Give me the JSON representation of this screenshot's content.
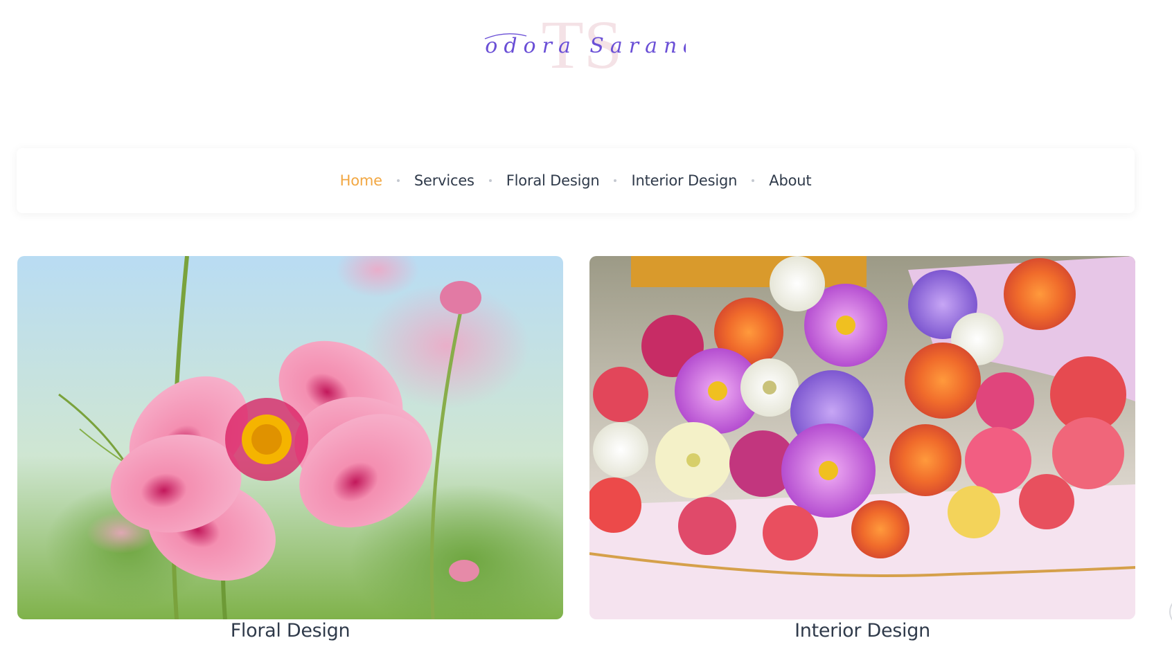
{
  "logo": {
    "monogram": "TS",
    "signature": "Teodora Sarandi",
    "colors": {
      "signature": "#6a4fd6",
      "monogram": "#f3dde2"
    }
  },
  "nav": {
    "items": [
      {
        "label": "Home",
        "active": true
      },
      {
        "label": "Services",
        "active": false
      },
      {
        "label": "Floral Design",
        "active": false
      },
      {
        "label": "Interior Design",
        "active": false
      },
      {
        "label": "About",
        "active": false
      }
    ],
    "colors": {
      "active": "#f2a742",
      "default": "#2f3a4a"
    }
  },
  "cards": [
    {
      "title": "Floral Design",
      "image": "pink-cosmos-flower-photo"
    },
    {
      "title": "Interior Design",
      "image": "flower-bouquet-photo"
    }
  ],
  "scroll_top_icon": "scroll-to-top-icon"
}
